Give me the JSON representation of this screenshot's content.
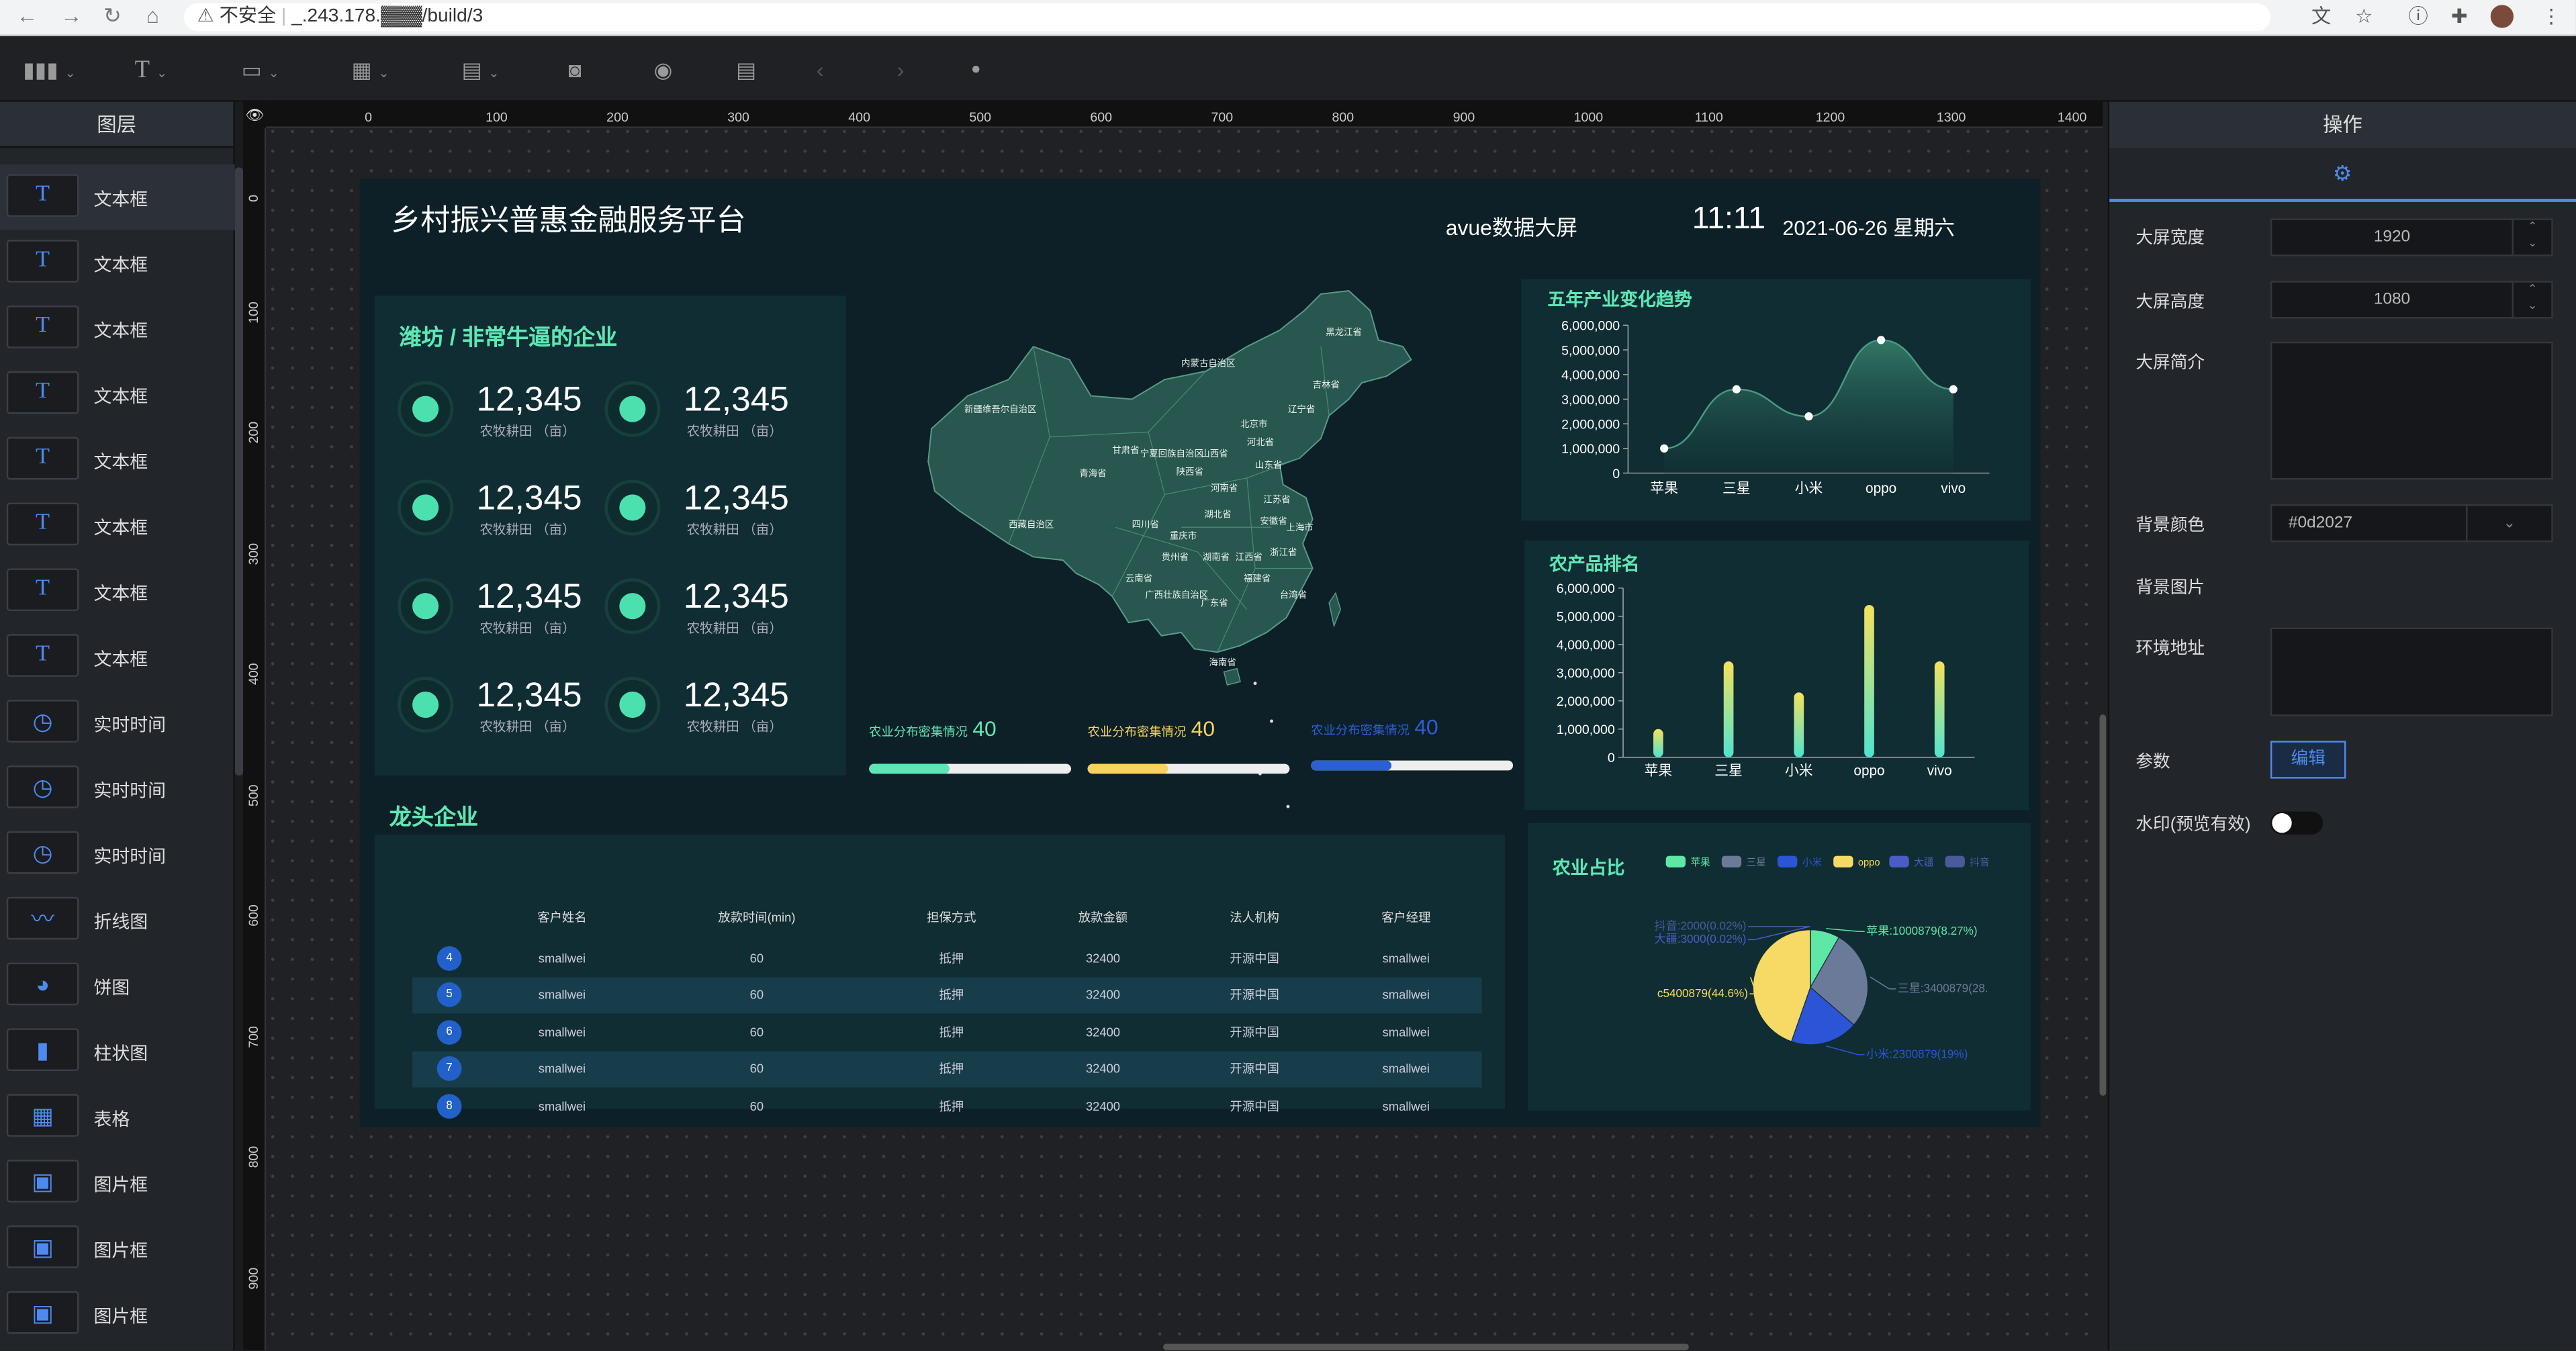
{
  "browser": {
    "security": "不安全",
    "url": "_.243.178.▓▓▓/build/3"
  },
  "left_panel": {
    "title": "图层",
    "layers": [
      {
        "label": "文本框",
        "icon": "text-icon"
      },
      {
        "label": "文本框",
        "icon": "text-icon"
      },
      {
        "label": "文本框",
        "icon": "text-icon"
      },
      {
        "label": "文本框",
        "icon": "text-icon"
      },
      {
        "label": "文本框",
        "icon": "text-icon"
      },
      {
        "label": "文本框",
        "icon": "text-icon"
      },
      {
        "label": "文本框",
        "icon": "text-icon"
      },
      {
        "label": "文本框",
        "icon": "text-icon"
      },
      {
        "label": "实时时间",
        "icon": "clock-icon"
      },
      {
        "label": "实时时间",
        "icon": "clock-icon"
      },
      {
        "label": "实时时间",
        "icon": "clock-icon"
      },
      {
        "label": "折线图",
        "icon": "line-chart-icon"
      },
      {
        "label": "饼图",
        "icon": "pie-chart-icon"
      },
      {
        "label": "柱状图",
        "icon": "bar-chart-icon"
      },
      {
        "label": "表格",
        "icon": "table-icon"
      },
      {
        "label": "图片框",
        "icon": "image-icon"
      },
      {
        "label": "图片框",
        "icon": "image-icon"
      },
      {
        "label": "图片框",
        "icon": "image-icon"
      }
    ]
  },
  "ruler": {
    "h_ticks": [
      "0",
      "100",
      "200",
      "300",
      "400",
      "500",
      "600",
      "700",
      "800",
      "900",
      "1000",
      "1100",
      "1200",
      "1300",
      "1400"
    ],
    "v_ticks": [
      "0",
      "100",
      "200",
      "300",
      "400",
      "500",
      "600",
      "700",
      "800",
      "900"
    ]
  },
  "screen": {
    "title": "乡村振兴普惠金融服务平台",
    "subtitle": "avue数据大屏",
    "time": "11:11",
    "date": "2021-06-26  星期六",
    "company_panel": {
      "title": "潍坊 / 非常牛逼的企业",
      "stats": [
        {
          "value": "12,345",
          "unit": "农牧耕田 （亩）"
        },
        {
          "value": "12,345",
          "unit": "农牧耕田 （亩）"
        },
        {
          "value": "12,345",
          "unit": "农牧耕田 （亩）"
        },
        {
          "value": "12,345",
          "unit": "农牧耕田 （亩）"
        },
        {
          "value": "12,345",
          "unit": "农牧耕田 （亩）"
        },
        {
          "value": "12,345",
          "unit": "农牧耕田 （亩）"
        },
        {
          "value": "12,345",
          "unit": "农牧耕田 （亩）"
        },
        {
          "value": "12,345",
          "unit": "农牧耕田 （亩）"
        }
      ]
    },
    "map_labels": [
      "新疆维吾尔自治区",
      "内蒙古自治区",
      "黑龙江省",
      "吉林省",
      "辽宁省",
      "北京市",
      "河北省",
      "甘肃省",
      "宁夏回族自治区",
      "山西省",
      "山东省",
      "青海省",
      "陕西省",
      "河南省",
      "江苏省",
      "西藏自治区",
      "四川省",
      "湖北省",
      "安徽省",
      "上海市",
      "重庆市",
      "浙江省",
      "贵州省",
      "湖南省",
      "江西省",
      "云南省",
      "福建省",
      "广西壮族自治区",
      "广东省",
      "台湾省",
      "海南省"
    ],
    "progress": [
      {
        "label": "农业分布密集情况",
        "value": "40",
        "percent": 40,
        "color": "#5ee7b5"
      },
      {
        "label": "农业分布密集情况",
        "value": "40",
        "percent": 40,
        "color": "#f7d35e"
      },
      {
        "label": "农业分布密集情况",
        "value": "40",
        "percent": 40,
        "color": "#2b5fd6"
      }
    ],
    "leader_title": "龙头企业",
    "table": {
      "columns": [
        "客户姓名",
        "放款时间(min)",
        "担保方式",
        "放款金额",
        "法人机构",
        "客户经理"
      ],
      "rows": [
        {
          "rank": "4",
          "cells": [
            "smallwei",
            "60",
            "抵押",
            "32400",
            "开源中国",
            "smallwei"
          ]
        },
        {
          "rank": "5",
          "cells": [
            "smallwei",
            "60",
            "抵押",
            "32400",
            "开源中国",
            "smallwei"
          ]
        },
        {
          "rank": "6",
          "cells": [
            "smallwei",
            "60",
            "抵押",
            "32400",
            "开源中国",
            "smallwei"
          ]
        },
        {
          "rank": "7",
          "cells": [
            "smallwei",
            "60",
            "抵押",
            "32400",
            "开源中国",
            "smallwei"
          ]
        },
        {
          "rank": "8",
          "cells": [
            "smallwei",
            "60",
            "抵押",
            "32400",
            "开源中国",
            "smallwei"
          ]
        }
      ]
    }
  },
  "chart_data": [
    {
      "type": "area",
      "title": "五年产业变化趋势",
      "categories": [
        "苹果",
        "三星",
        "小米",
        "oppo",
        "vivo"
      ],
      "values": [
        1000000,
        3400000,
        2300000,
        5400000,
        3400000
      ],
      "ylim": [
        0,
        6000000
      ],
      "yticks": [
        "6,000,000",
        "5,000,000",
        "4,000,000",
        "3,000,000",
        "2,000,000",
        "1,000,000",
        "0"
      ]
    },
    {
      "type": "bar",
      "title": "农产品排名",
      "categories": [
        "苹果",
        "三星",
        "小米",
        "oppo",
        "vivo"
      ],
      "values": [
        1000000,
        3400000,
        2300000,
        5400000,
        3400000
      ],
      "ylim": [
        0,
        6000000
      ],
      "yticks": [
        "6,000,000",
        "5,000,000",
        "4,000,000",
        "3,000,000",
        "2,000,000",
        "1,000,000",
        "0"
      ]
    },
    {
      "type": "pie",
      "title": "农业占比",
      "legend": [
        "苹果",
        "三星",
        "小米",
        "oppo",
        "大疆",
        "抖音"
      ],
      "slices": [
        {
          "name": "苹果",
          "value": 1000879,
          "label": "苹果:1000879(8.27%)",
          "color": "#5ee7a5"
        },
        {
          "name": "三星",
          "value": 3400879,
          "label": "三星:3400879(28.",
          "color": "#6b7a99"
        },
        {
          "name": "小米",
          "value": 2300879,
          "label": "小米:2300879(19%)",
          "color": "#2b55d6"
        },
        {
          "name": "oppo",
          "value": 5400879,
          "label": "c5400879(44.6%)",
          "color": "#f7d966"
        },
        {
          "name": "大疆",
          "value": 3000,
          "label": "大疆:3000(0.02%)",
          "color": "#4b5cc4"
        },
        {
          "name": "抖音",
          "value": 2000,
          "label": "抖音:2000(0.02%)",
          "color": "#4a5a9a"
        }
      ]
    }
  ],
  "right_panel": {
    "title": "操作",
    "width_label": "大屏宽度",
    "width_value": "1920",
    "height_label": "大屏高度",
    "height_value": "1080",
    "intro_label": "大屏简介",
    "bg_color_label": "背景颜色",
    "bg_color_value": "#0d2027",
    "bg_image_label": "背景图片",
    "env_label": "环境地址",
    "param_label": "参数",
    "edit_button": "编辑",
    "watermark_label": "水印(预览有效)",
    "watermark_on": false
  }
}
